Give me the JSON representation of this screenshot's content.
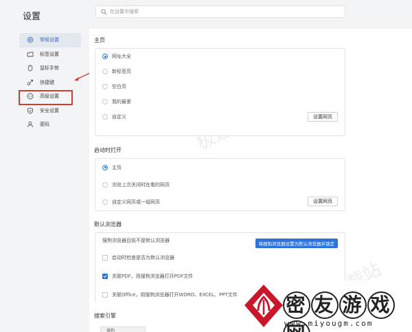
{
  "app": {
    "title": "设置"
  },
  "search": {
    "placeholder": "在设置中搜索"
  },
  "sidebar": {
    "items": [
      {
        "label": "常规设置",
        "icon": "gear-icon"
      },
      {
        "label": "标签设置",
        "icon": "tab-icon"
      },
      {
        "label": "鼠标手势",
        "icon": "mouse-icon"
      },
      {
        "label": "快捷键",
        "icon": "shortcut-icon"
      },
      {
        "label": "高级设置",
        "icon": "more-icon"
      },
      {
        "label": "安全设置",
        "icon": "shield-icon"
      },
      {
        "label": "密码",
        "icon": "user-icon"
      }
    ]
  },
  "homepage": {
    "title": "主页",
    "options": [
      "网址大全",
      "新标签页",
      "空白页",
      "我的最爱",
      "自定义"
    ],
    "set_button": "设置网页"
  },
  "startup": {
    "title": "启动时打开",
    "options": [
      "主页",
      "浏览上次关闭时在看的网页",
      "自定义网页或一组网页"
    ],
    "set_button": "设置网页"
  },
  "default_browser": {
    "title": "默认浏览器",
    "status": "搜狗浏览器目前不是默认浏览器",
    "set_button": "将搜狗浏览器设置为默认浏览器并锁定",
    "options": [
      {
        "label": "启动时检查是否为默认浏览器",
        "checked": false
      },
      {
        "label": "关联PDF，用搜狗浏览器打开PDF文件",
        "checked": true
      },
      {
        "label": "关联Office，用搜狗浏览器打开WORD、EXCEL、PPT文件",
        "checked": false
      }
    ]
  },
  "search_engine": {
    "title": "搜索引擎",
    "current": "搜狗"
  },
  "watermark": {
    "text": "极速下载站",
    "logo_text": "密友游戏网",
    "logo_url": "www.miyougm.com"
  },
  "colors": {
    "accent": "#2e73d9",
    "highlight": "#d23b2f"
  }
}
